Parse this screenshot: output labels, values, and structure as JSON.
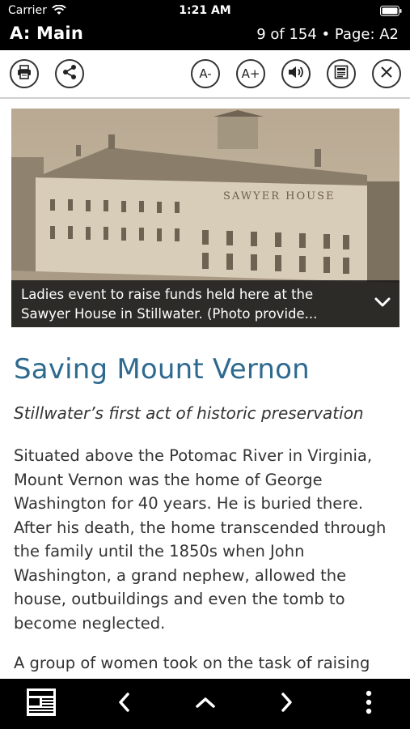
{
  "status_bar": {
    "carrier": "Carrier",
    "time": "1:21 AM"
  },
  "header": {
    "section": "A: Main",
    "page_info": "9 of 154 • Page: A2"
  },
  "toolbar": {
    "print_icon": "printer-icon",
    "share_icon": "share-icon",
    "font_decrease_label": "A-",
    "font_increase_label": "A+",
    "audio_icon": "speaker-icon",
    "page_view_icon": "newspaper-icon",
    "close_icon": "close-icon"
  },
  "photo": {
    "sign_text": "SAWYER HOUSE",
    "caption": "Ladies event to raise funds held here at the Sawyer House in Stillwater. (Photo provide..."
  },
  "article": {
    "headline": "Saving Mount Vernon",
    "subhead": "Stillwater’s first act of historic preservation",
    "paragraphs": [
      "Situated above the Potomac River in Virginia, Mount Vernon was the home of George Washington for 40 years. He is buried there. After his death, the home transcended through the family until the 1850s when John Washington, a grand nephew, allowed the house, outbuildings and even the tomb to become neglected.",
      "A group of women took on the task of raising"
    ]
  },
  "bottom_bar": {
    "icons": [
      "newspaper-icon",
      "chevron-left-icon",
      "chevron-up-icon",
      "chevron-right-icon",
      "more-vertical-icon"
    ]
  },
  "colors": {
    "headline": "#2e6a8f",
    "bars": "#000000"
  }
}
